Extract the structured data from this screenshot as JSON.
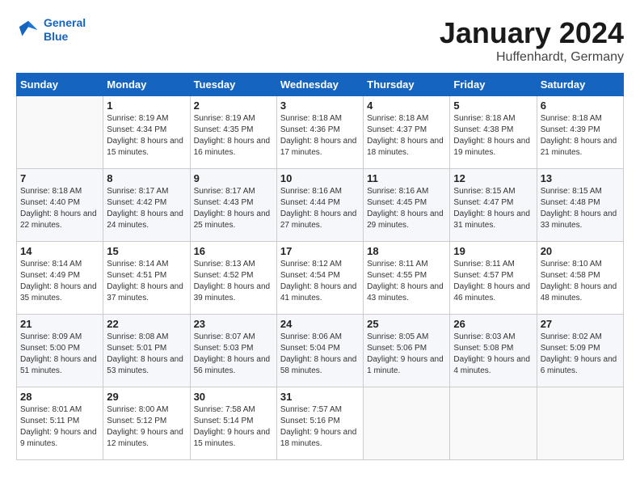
{
  "header": {
    "logo_line1": "General",
    "logo_line2": "Blue",
    "month": "January 2024",
    "location": "Huffenhardt, Germany"
  },
  "weekdays": [
    "Sunday",
    "Monday",
    "Tuesday",
    "Wednesday",
    "Thursday",
    "Friday",
    "Saturday"
  ],
  "weeks": [
    [
      {
        "day": "",
        "sunrise": "",
        "sunset": "",
        "daylight": ""
      },
      {
        "day": "1",
        "sunrise": "8:19 AM",
        "sunset": "4:34 PM",
        "daylight": "8 hours and 15 minutes."
      },
      {
        "day": "2",
        "sunrise": "8:19 AM",
        "sunset": "4:35 PM",
        "daylight": "8 hours and 16 minutes."
      },
      {
        "day": "3",
        "sunrise": "8:18 AM",
        "sunset": "4:36 PM",
        "daylight": "8 hours and 17 minutes."
      },
      {
        "day": "4",
        "sunrise": "8:18 AM",
        "sunset": "4:37 PM",
        "daylight": "8 hours and 18 minutes."
      },
      {
        "day": "5",
        "sunrise": "8:18 AM",
        "sunset": "4:38 PM",
        "daylight": "8 hours and 19 minutes."
      },
      {
        "day": "6",
        "sunrise": "8:18 AM",
        "sunset": "4:39 PM",
        "daylight": "8 hours and 21 minutes."
      }
    ],
    [
      {
        "day": "7",
        "sunrise": "8:18 AM",
        "sunset": "4:40 PM",
        "daylight": "8 hours and 22 minutes."
      },
      {
        "day": "8",
        "sunrise": "8:17 AM",
        "sunset": "4:42 PM",
        "daylight": "8 hours and 24 minutes."
      },
      {
        "day": "9",
        "sunrise": "8:17 AM",
        "sunset": "4:43 PM",
        "daylight": "8 hours and 25 minutes."
      },
      {
        "day": "10",
        "sunrise": "8:16 AM",
        "sunset": "4:44 PM",
        "daylight": "8 hours and 27 minutes."
      },
      {
        "day": "11",
        "sunrise": "8:16 AM",
        "sunset": "4:45 PM",
        "daylight": "8 hours and 29 minutes."
      },
      {
        "day": "12",
        "sunrise": "8:15 AM",
        "sunset": "4:47 PM",
        "daylight": "8 hours and 31 minutes."
      },
      {
        "day": "13",
        "sunrise": "8:15 AM",
        "sunset": "4:48 PM",
        "daylight": "8 hours and 33 minutes."
      }
    ],
    [
      {
        "day": "14",
        "sunrise": "8:14 AM",
        "sunset": "4:49 PM",
        "daylight": "8 hours and 35 minutes."
      },
      {
        "day": "15",
        "sunrise": "8:14 AM",
        "sunset": "4:51 PM",
        "daylight": "8 hours and 37 minutes."
      },
      {
        "day": "16",
        "sunrise": "8:13 AM",
        "sunset": "4:52 PM",
        "daylight": "8 hours and 39 minutes."
      },
      {
        "day": "17",
        "sunrise": "8:12 AM",
        "sunset": "4:54 PM",
        "daylight": "8 hours and 41 minutes."
      },
      {
        "day": "18",
        "sunrise": "8:11 AM",
        "sunset": "4:55 PM",
        "daylight": "8 hours and 43 minutes."
      },
      {
        "day": "19",
        "sunrise": "8:11 AM",
        "sunset": "4:57 PM",
        "daylight": "8 hours and 46 minutes."
      },
      {
        "day": "20",
        "sunrise": "8:10 AM",
        "sunset": "4:58 PM",
        "daylight": "8 hours and 48 minutes."
      }
    ],
    [
      {
        "day": "21",
        "sunrise": "8:09 AM",
        "sunset": "5:00 PM",
        "daylight": "8 hours and 51 minutes."
      },
      {
        "day": "22",
        "sunrise": "8:08 AM",
        "sunset": "5:01 PM",
        "daylight": "8 hours and 53 minutes."
      },
      {
        "day": "23",
        "sunrise": "8:07 AM",
        "sunset": "5:03 PM",
        "daylight": "8 hours and 56 minutes."
      },
      {
        "day": "24",
        "sunrise": "8:06 AM",
        "sunset": "5:04 PM",
        "daylight": "8 hours and 58 minutes."
      },
      {
        "day": "25",
        "sunrise": "8:05 AM",
        "sunset": "5:06 PM",
        "daylight": "9 hours and 1 minute."
      },
      {
        "day": "26",
        "sunrise": "8:03 AM",
        "sunset": "5:08 PM",
        "daylight": "9 hours and 4 minutes."
      },
      {
        "day": "27",
        "sunrise": "8:02 AM",
        "sunset": "5:09 PM",
        "daylight": "9 hours and 6 minutes."
      }
    ],
    [
      {
        "day": "28",
        "sunrise": "8:01 AM",
        "sunset": "5:11 PM",
        "daylight": "9 hours and 9 minutes."
      },
      {
        "day": "29",
        "sunrise": "8:00 AM",
        "sunset": "5:12 PM",
        "daylight": "9 hours and 12 minutes."
      },
      {
        "day": "30",
        "sunrise": "7:58 AM",
        "sunset": "5:14 PM",
        "daylight": "9 hours and 15 minutes."
      },
      {
        "day": "31",
        "sunrise": "7:57 AM",
        "sunset": "5:16 PM",
        "daylight": "9 hours and 18 minutes."
      },
      {
        "day": "",
        "sunrise": "",
        "sunset": "",
        "daylight": ""
      },
      {
        "day": "",
        "sunrise": "",
        "sunset": "",
        "daylight": ""
      },
      {
        "day": "",
        "sunrise": "",
        "sunset": "",
        "daylight": ""
      }
    ]
  ]
}
